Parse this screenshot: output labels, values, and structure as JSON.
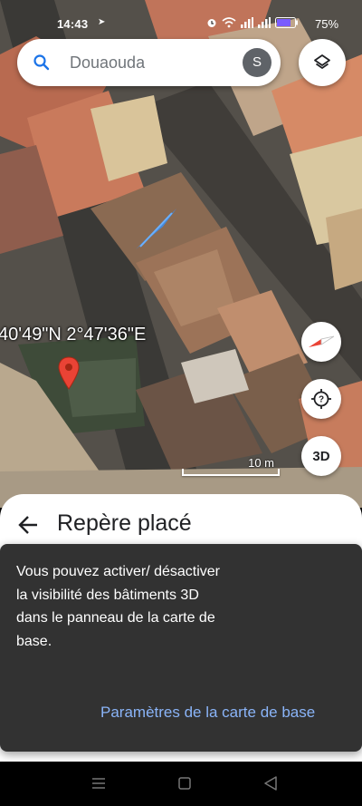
{
  "status_bar": {
    "time": "14:43",
    "battery_percent": "75%",
    "icons": [
      "navigation-icon",
      "alarm-icon",
      "wifi-icon",
      "signal-icon",
      "signal-icon",
      "battery-icon"
    ]
  },
  "search": {
    "query": "Douaouda",
    "avatar_letter": "S"
  },
  "map": {
    "coordinates": "40'49\"N 2°47'36\"E",
    "scale_label": "10 m",
    "three_d_label": "3D",
    "accent_pin_color": "#ea4335"
  },
  "sheet": {
    "title": "Repère placé"
  },
  "snackbar": {
    "message": "Vous pouvez activer/ désactiver la visibilité des bâtiments 3D dans le panneau de la carte de base.",
    "action_label": "Paramètres de la carte de base",
    "action_color": "#8ab4f8"
  }
}
